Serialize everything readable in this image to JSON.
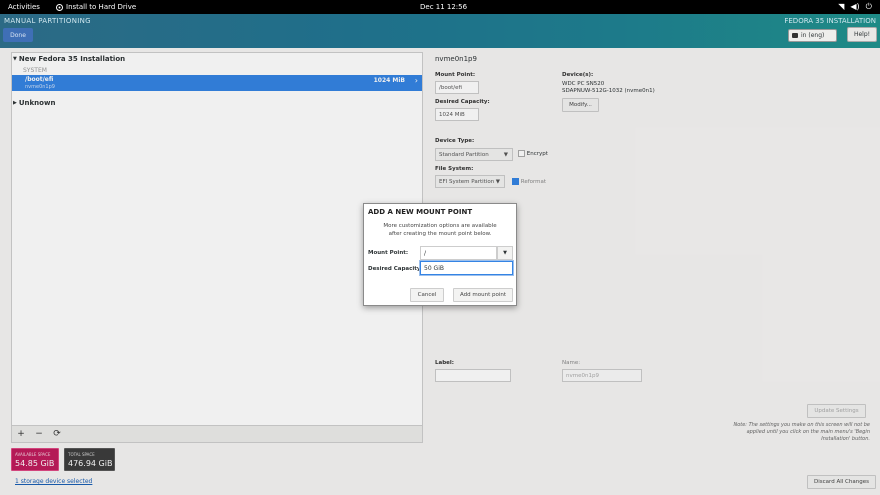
{
  "topbar": {
    "activities": "Activities",
    "app_name": "Install to Hard Drive",
    "clock": "Dec 11  12:56"
  },
  "header": {
    "section_title": "MANUAL PARTITIONING",
    "done_label": "Done",
    "product_title": "FEDORA 35 INSTALLATION",
    "keyboard": "in (eng)",
    "help_label": "Help!"
  },
  "tree": {
    "group_new": "New Fedora 35 Installation",
    "system_label": "SYSTEM",
    "selected": {
      "name": "/boot/efi",
      "device": "nvme0n1p9",
      "size": "1024 MiB"
    },
    "group_unknown": "Unknown"
  },
  "toolbar": {
    "add": "+",
    "remove": "−",
    "refresh": "⟳"
  },
  "space": {
    "available_label": "AVAILABLE SPACE",
    "available_value": "54.85 GiB",
    "total_label": "TOTAL SPACE",
    "total_value": "476.94 GiB"
  },
  "storage_link": "1 storage device selected",
  "details": {
    "device_name": "nvme0n1p9",
    "mount_point_label": "Mount Point:",
    "mount_point_value": "/boot/efi",
    "desired_capacity_label": "Desired Capacity:",
    "desired_capacity_value": "1024 MiB",
    "devices_label": "Device(s):",
    "device_line1": "WDC PC SN520",
    "device_line2": "SDAPNUW-512G-1032 (nvme0n1)",
    "modify_label": "Modify...",
    "device_type_label": "Device Type:",
    "device_type_value": "Standard Partition",
    "encrypt_label": "Encrypt",
    "file_system_label": "File System:",
    "file_system_value": "EFI System Partition",
    "reformat_label": "Reformat",
    "label_label": "Label:",
    "name_label": "Name:",
    "name_value": "nvme0n1p9",
    "update_label": "Update Settings",
    "note": "Note:  The settings you make on this screen will not be applied until you click on the main menu's 'Begin Installation' button.",
    "discard_label": "Discard All Changes"
  },
  "dialog": {
    "title": "ADD A NEW MOUNT POINT",
    "description_line1": "More customization options are available",
    "description_line2": "after creating the mount point below.",
    "mount_point_label": "Mount Point:",
    "mount_point_value": "/",
    "capacity_label": "Desired Capacity:",
    "capacity_value": "50 GiB",
    "cancel_label": "Cancel",
    "add_label": "Add mount point"
  }
}
